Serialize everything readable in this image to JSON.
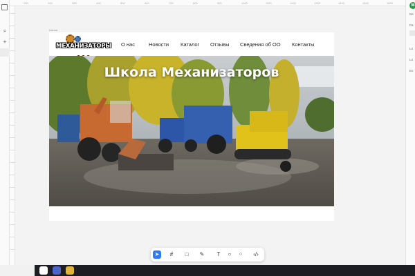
{
  "editor": {
    "frame_label": "Школа",
    "left_tools": [
      "frame-tool",
      "search-tool",
      "add-tool"
    ],
    "ruler_ticks": [
      "100",
      "200",
      "300",
      "400",
      "500",
      "600",
      "700",
      "800",
      "900",
      "1000",
      "1100",
      "1200",
      "1300",
      "1400",
      "1500",
      "1600"
    ],
    "right_panel": {
      "avatar_letter": "M",
      "labels": [
        "De",
        "Pa",
        "Lo",
        "Lo",
        "Ex"
      ]
    },
    "bottom_toolbar": {
      "tools": [
        "pointer-icon",
        "frame-icon",
        "rectangle-icon",
        "pen-icon",
        "text-icon",
        "comment-icon",
        "components-icon",
        "code-icon"
      ],
      "active": "pointer-icon",
      "text_glyph": "T"
    }
  },
  "site": {
    "logo_text": "МЕХАНИЗАТОРЫ",
    "menu": [
      "О нас",
      "Новости",
      "Каталог",
      "Отзывы",
      "Сведения об ОО",
      "Контакты"
    ],
    "hero_title": "Школа Механизаторов"
  },
  "colors": {
    "active_tool": "#2f7cf6",
    "avatar": "#2a9a4a",
    "logo_gear": "#d08a2b"
  }
}
